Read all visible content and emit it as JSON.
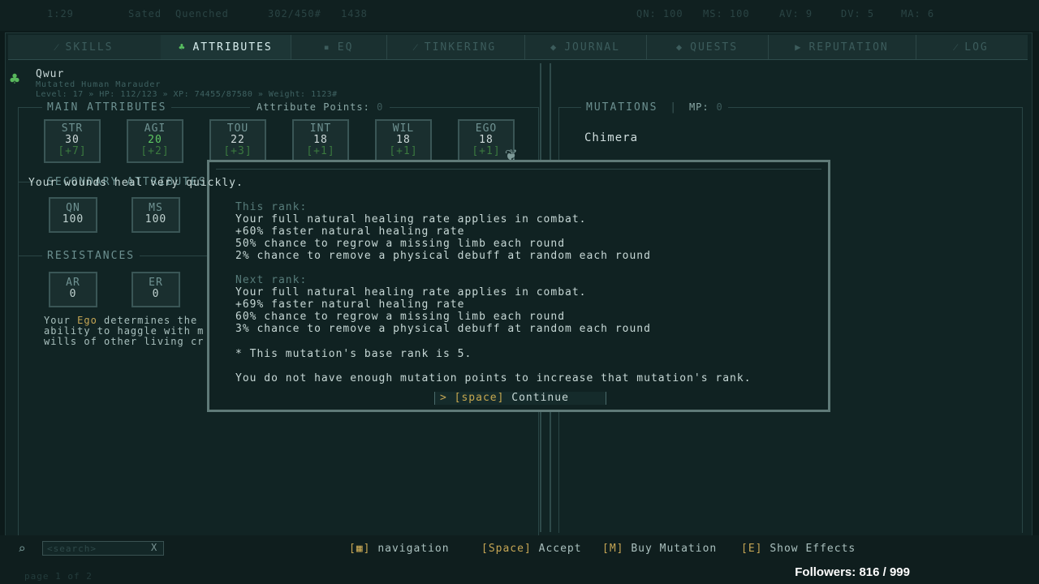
{
  "topbar": {
    "time": "1:29",
    "hunger": "Sated",
    "thirst": "Quenched",
    "weight_info": "302/450#",
    "money": "1438",
    "qn": "QN: 100",
    "ms": "MS: 100",
    "av": "AV: 9",
    "dv": "DV: 5",
    "ma": "MA: 6"
  },
  "tabs": [
    {
      "label": "SKILLS",
      "icon": "sword-icon"
    },
    {
      "label": "ATTRIBUTES",
      "icon": "person-icon"
    },
    {
      "label": "EQ",
      "icon": "armor-icon"
    },
    {
      "label": "TINKERING",
      "icon": "tools-icon"
    },
    {
      "label": "JOURNAL",
      "icon": "book-icon"
    },
    {
      "label": "QUESTS",
      "icon": "scroll-icon"
    },
    {
      "label": "REPUTATION",
      "icon": "flag-icon"
    },
    {
      "label": "LOG",
      "icon": "quill-icon"
    }
  ],
  "character": {
    "name": "Qwur",
    "subtitle": "Mutated Human Marauder",
    "stats_line": "Level: 17 » HP: 112/123 » XP: 74455/87580 » Weight: 1123#"
  },
  "main_attributes": {
    "title": "MAIN ATTRIBUTES",
    "points_label": "Attribute Points:",
    "points_value": "0",
    "items": [
      {
        "label": "STR",
        "value": "30",
        "bonus": "[+7]"
      },
      {
        "label": "AGI",
        "value": "20",
        "bonus": "[+2]"
      },
      {
        "label": "TOU",
        "value": "22",
        "bonus": "[+3]"
      },
      {
        "label": "INT",
        "value": "18",
        "bonus": "[+1]"
      },
      {
        "label": "WIL",
        "value": "18",
        "bonus": "[+1]"
      },
      {
        "label": "EGO",
        "value": "18",
        "bonus": "[+1]"
      }
    ]
  },
  "secondary_attributes": {
    "title": "SECONDARY ATTRIBUTES",
    "items": [
      {
        "label": "QN",
        "value": "100"
      },
      {
        "label": "MS",
        "value": "100"
      }
    ]
  },
  "resistances": {
    "title": "RESISTANCES",
    "items": [
      {
        "label": "AR",
        "value": "0"
      },
      {
        "label": "ER",
        "value": "0"
      }
    ]
  },
  "ego_desc": {
    "line1_pre": "Your ",
    "line1_kw": "Ego",
    "line1_post": " determines the",
    "line2": "ability to haggle with m",
    "line3": "wills of other living cr"
  },
  "mutations": {
    "title": "MUTATIONS",
    "mp_label": "MP:",
    "mp_value": "0",
    "first": "Chimera"
  },
  "modal": {
    "intro": "Your wounds heal very quickly.",
    "this_rank_label": "This rank:",
    "this_rank": [
      "Your full natural healing rate applies in combat.",
      "+60% faster natural healing rate",
      "50% chance to regrow a missing limb each round",
      "2% chance to remove a physical debuff at random each round"
    ],
    "next_rank_label": "Next rank:",
    "next_rank": [
      "Your full natural healing rate applies in combat.",
      "+69% faster natural healing rate",
      "60% chance to regrow a missing limb each round",
      "3% chance to remove a physical debuff at random each round"
    ],
    "note": "* This mutation's base rank is 5.",
    "warning": "You do not have enough mutation points to increase that mutation's rank.",
    "continue_prefix": ">",
    "continue_key": "[space]",
    "continue_label": "Continue"
  },
  "bottom": {
    "search_placeholder": "<search>",
    "search_clear": "X",
    "hints": [
      {
        "key": "",
        "label": "navigation"
      },
      {
        "key": "[Space]",
        "label": "Accept"
      },
      {
        "key": "[M]",
        "label": "Buy Mutation"
      },
      {
        "key": "[E]",
        "label": "Show Effects"
      }
    ],
    "page": "page 1 of 2",
    "followers": "Followers: 816 / 999"
  }
}
